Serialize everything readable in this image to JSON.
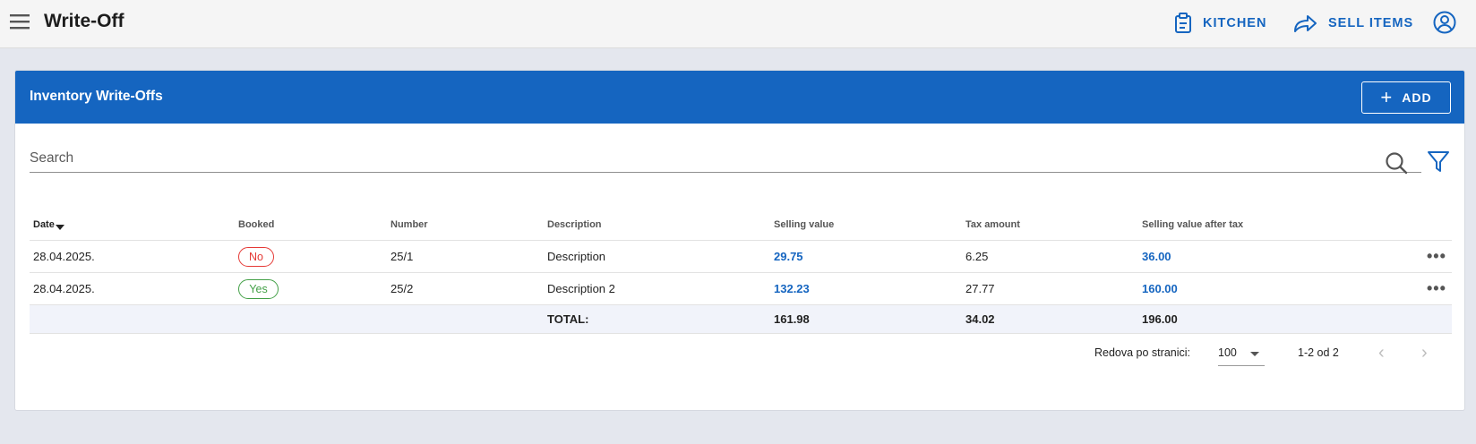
{
  "header": {
    "title": "Write-Off",
    "nav": [
      {
        "label": "KITCHEN",
        "icon": "clipboard-icon"
      },
      {
        "label": "SELL ITEMS",
        "icon": "share-arrow-icon"
      }
    ],
    "accent_color": "#1565c0"
  },
  "card": {
    "title": "Inventory Write-Offs",
    "add_label": "ADD"
  },
  "search": {
    "placeholder": "Search"
  },
  "table": {
    "columns": [
      "Date",
      "Booked",
      "Number",
      "Description",
      "Selling value",
      "Tax amount",
      "Selling value after tax"
    ],
    "rows": [
      {
        "date": "28.04.2025.",
        "booked": "No",
        "number": "25/1",
        "description": "Description",
        "selling_value": "29.75",
        "tax_amount": "6.25",
        "after_tax": "36.00"
      },
      {
        "date": "28.04.2025.",
        "booked": "Yes",
        "number": "25/2",
        "description": "Description 2",
        "selling_value": "132.23",
        "tax_amount": "27.77",
        "after_tax": "160.00"
      }
    ],
    "total": {
      "label": "TOTAL:",
      "selling_value": "161.98",
      "tax_amount": "34.02",
      "after_tax": "196.00"
    },
    "row_action": "•••"
  },
  "pagination": {
    "rows_per_page_label": "Redova po stranici:",
    "rows_per_page": "100",
    "range": "1-2 od 2",
    "prev": "‹",
    "next": "›"
  },
  "colors": {
    "no": "#e53935",
    "yes": "#43a047"
  }
}
